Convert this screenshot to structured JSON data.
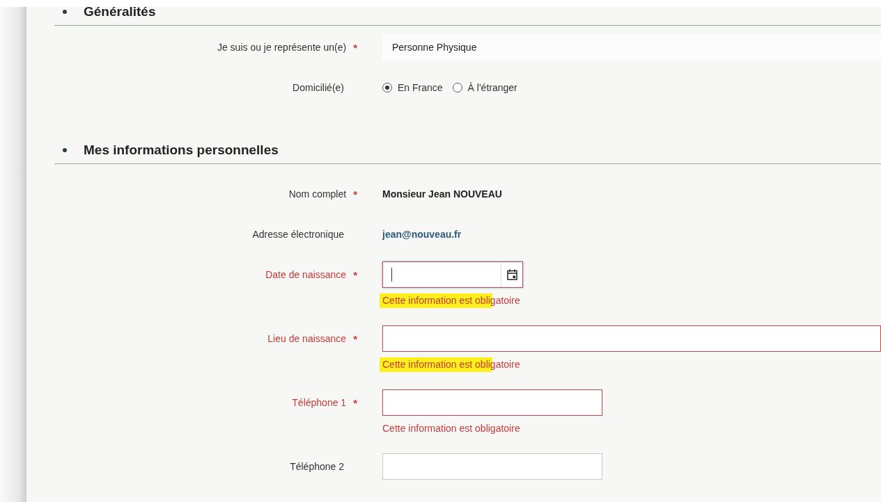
{
  "sections": [
    {
      "title": "Généralités",
      "rows": [
        {
          "kind": "text-field",
          "label": "Je suis ou je représente un(e)",
          "required_mark": "*",
          "error": false,
          "value": "Personne Physique"
        },
        {
          "kind": "radio",
          "label": "Domicilié(e)",
          "error": false,
          "options": [
            {
              "label": "En France",
              "selected": true
            },
            {
              "label": "À l'étranger",
              "selected": false
            }
          ]
        }
      ]
    },
    {
      "title": "Mes informations personnelles",
      "rows": [
        {
          "kind": "static",
          "label": "Nom complet",
          "required_mark": "*",
          "error": false,
          "value": "Monsieur Jean NOUVEAU"
        },
        {
          "kind": "link",
          "label": "Adresse électronique",
          "error": false,
          "value": "jean@nouveau.fr"
        },
        {
          "kind": "date",
          "label": "Date de naissance",
          "required_mark": "*",
          "error": true,
          "message": "Cette information est obligatoire",
          "highlighted": true
        },
        {
          "kind": "wide-input",
          "label": "Lieu de naissance",
          "required_mark": "*",
          "error": true,
          "message": "Cette information est obligatoire",
          "highlighted": true
        },
        {
          "kind": "input",
          "label": "Téléphone 1",
          "required_mark": "*",
          "error": true,
          "message": "Cette information est obligatoire"
        },
        {
          "kind": "input",
          "label": "Téléphone 2",
          "error": false
        }
      ]
    }
  ]
}
